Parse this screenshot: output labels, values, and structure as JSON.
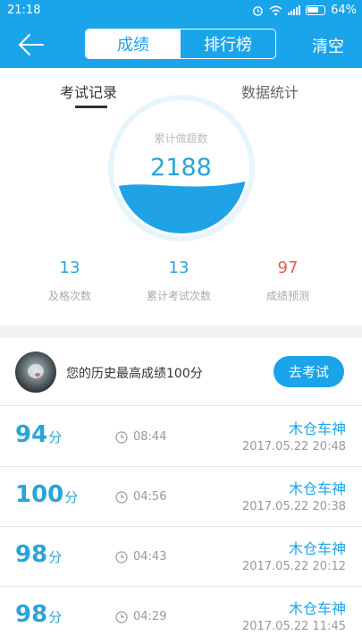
{
  "status": {
    "time": "21:18",
    "battery": "64%"
  },
  "header": {
    "tab_scores": "成绩",
    "tab_ranking": "排行榜",
    "clear": "清空"
  },
  "subtabs": {
    "exam_records": "考试记录",
    "data_stats": "数据统计"
  },
  "gauge": {
    "label": "累计做题数",
    "value": "2188",
    "fill_level": 0.38
  },
  "stats": [
    {
      "value": "13",
      "label": "及格次数",
      "color": "#2aa4d8"
    },
    {
      "value": "13",
      "label": "累计考试次数",
      "color": "#2aa4d8"
    },
    {
      "value": "97",
      "label": "成绩预测",
      "color": "#e85a4f"
    }
  ],
  "best": {
    "text": "您的历史最高成绩100分",
    "button": "去考试"
  },
  "records": [
    {
      "score": "94",
      "unit": "分",
      "duration": "08:44",
      "name": "木仓车神",
      "date": "2017.05.22  20:48"
    },
    {
      "score": "100",
      "unit": "分",
      "duration": "04:56",
      "name": "木仓车神",
      "date": "2017.05.22  20:38"
    },
    {
      "score": "98",
      "unit": "分",
      "duration": "04:43",
      "name": "木仓车神",
      "date": "2017.05.22  20:12"
    },
    {
      "score": "98",
      "unit": "分",
      "duration": "04:29",
      "name": "木仓车神",
      "date": "2017.05.22  11:45"
    }
  ],
  "colors": {
    "accent": "#1aa4ea",
    "score": "#2aa4d8",
    "prediction": "#e85a4f"
  }
}
